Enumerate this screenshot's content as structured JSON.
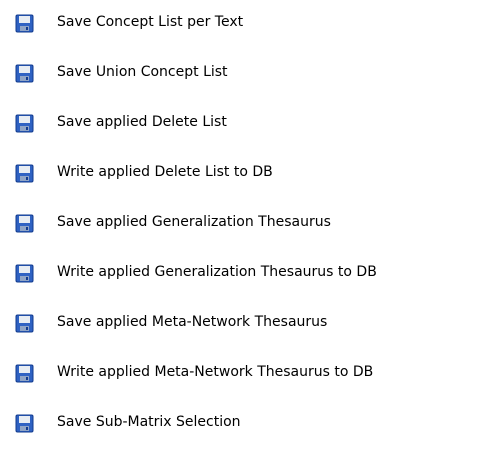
{
  "menu": {
    "items": [
      {
        "label": "Save Concept List per Text",
        "icon": "floppy-disk-save-icon"
      },
      {
        "label": "Save Union Concept List",
        "icon": "floppy-disk-save-icon"
      },
      {
        "label": "Save applied Delete List",
        "icon": "floppy-disk-save-icon"
      },
      {
        "label": "Write applied Delete List to DB",
        "icon": "floppy-disk-save-icon"
      },
      {
        "label": "Save applied Generalization Thesaurus",
        "icon": "floppy-disk-save-icon"
      },
      {
        "label": "Write applied Generalization Thesaurus to DB",
        "icon": "floppy-disk-save-icon"
      },
      {
        "label": "Save applied Meta-Network Thesaurus",
        "icon": "floppy-disk-save-icon"
      },
      {
        "label": "Write applied Meta-Network Thesaurus to DB",
        "icon": "floppy-disk-save-icon"
      },
      {
        "label": "Save Sub-Matrix Selection",
        "icon": "floppy-disk-save-icon"
      }
    ]
  },
  "colors": {
    "icon_body": "#2f62c3",
    "icon_dark": "#123b8e",
    "icon_label": "#e8edf3",
    "icon_shutter": "#8fa4c6"
  }
}
